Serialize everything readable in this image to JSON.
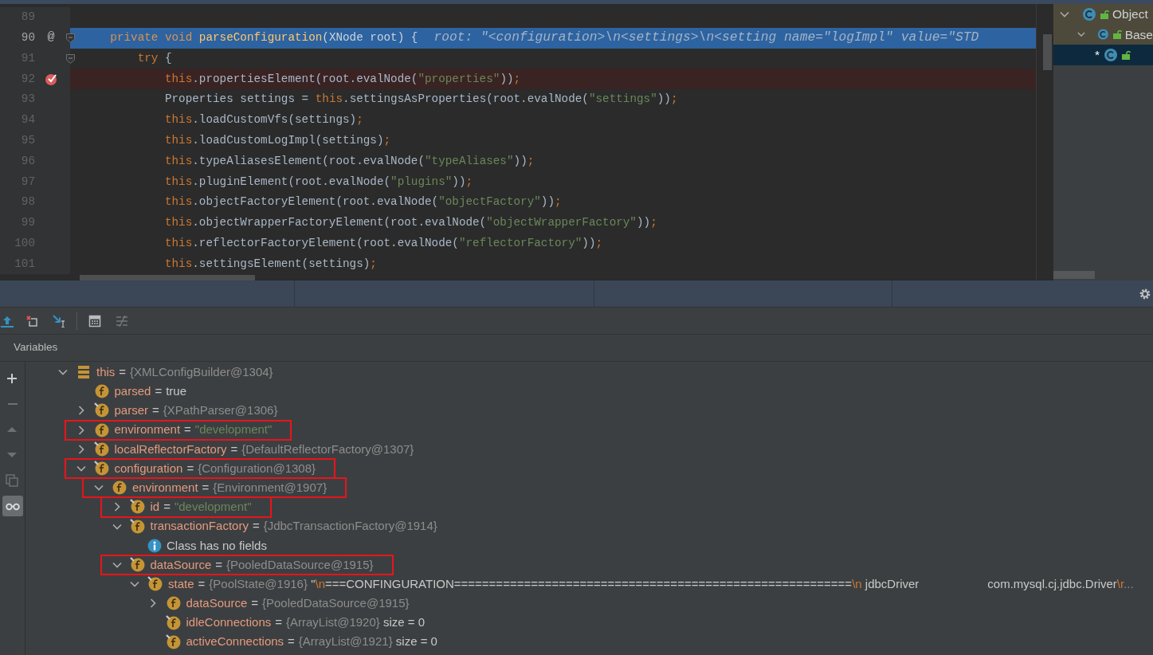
{
  "editor": {
    "lines": [
      {
        "number": "89"
      },
      {
        "number": "90",
        "current": true,
        "gutter_mark": "@",
        "foldable": true,
        "code": [
          {
            "kind": "kw",
            "text": "    private void "
          },
          {
            "kind": "fn",
            "text": "parseConfiguration"
          },
          {
            "kind": "plain",
            "text": "(XNode root) {"
          }
        ],
        "hint": "root: \"<configuration>\\n<settings>\\n<setting name=\"logImpl\" value=\"STD"
      },
      {
        "number": "91",
        "foldable": true,
        "code": [
          {
            "kind": "kw",
            "text": "        try"
          },
          {
            "kind": "plain",
            "text": " {"
          }
        ]
      },
      {
        "number": "92",
        "breakpoint": true,
        "code": [
          {
            "kind": "kw",
            "text": "            this"
          },
          {
            "kind": "plain",
            "text": ".propertiesElement(root.evalNode("
          },
          {
            "kind": "str",
            "text": "\"properties\""
          },
          {
            "kind": "plain",
            "text": "))"
          },
          {
            "kind": "semi",
            "text": ";"
          }
        ]
      },
      {
        "number": "93",
        "code": [
          {
            "kind": "plain",
            "text": "            Properties settings = "
          },
          {
            "kind": "kw",
            "text": "this"
          },
          {
            "kind": "plain",
            "text": ".settingsAsProperties(root.evalNode("
          },
          {
            "kind": "str",
            "text": "\"settings\""
          },
          {
            "kind": "plain",
            "text": "))"
          },
          {
            "kind": "semi",
            "text": ";"
          }
        ]
      },
      {
        "number": "94",
        "code": [
          {
            "kind": "kw",
            "text": "            this"
          },
          {
            "kind": "plain",
            "text": ".loadCustomVfs(settings)"
          },
          {
            "kind": "semi",
            "text": ";"
          }
        ]
      },
      {
        "number": "95",
        "code": [
          {
            "kind": "kw",
            "text": "            this"
          },
          {
            "kind": "plain",
            "text": ".loadCustomLogImpl(settings)"
          },
          {
            "kind": "semi",
            "text": ";"
          }
        ]
      },
      {
        "number": "96",
        "code": [
          {
            "kind": "kw",
            "text": "            this"
          },
          {
            "kind": "plain",
            "text": ".typeAliasesElement(root.evalNode("
          },
          {
            "kind": "str",
            "text": "\"typeAliases\""
          },
          {
            "kind": "plain",
            "text": "))"
          },
          {
            "kind": "semi",
            "text": ";"
          }
        ]
      },
      {
        "number": "97",
        "code": [
          {
            "kind": "kw",
            "text": "            this"
          },
          {
            "kind": "plain",
            "text": ".pluginElement(root.evalNode("
          },
          {
            "kind": "str",
            "text": "\"plugins\""
          },
          {
            "kind": "plain",
            "text": "))"
          },
          {
            "kind": "semi",
            "text": ";"
          }
        ]
      },
      {
        "number": "98",
        "code": [
          {
            "kind": "kw",
            "text": "            this"
          },
          {
            "kind": "plain",
            "text": ".objectFactoryElement(root.evalNode("
          },
          {
            "kind": "str",
            "text": "\"objectFactory\""
          },
          {
            "kind": "plain",
            "text": "))"
          },
          {
            "kind": "semi",
            "text": ";"
          }
        ]
      },
      {
        "number": "99",
        "code": [
          {
            "kind": "kw",
            "text": "            this"
          },
          {
            "kind": "plain",
            "text": ".objectWrapperFactoryElement(root.evalNode("
          },
          {
            "kind": "str",
            "text": "\"objectWrapperFactory\""
          },
          {
            "kind": "plain",
            "text": "))"
          },
          {
            "kind": "semi",
            "text": ";"
          }
        ]
      },
      {
        "number": "100",
        "code": [
          {
            "kind": "kw",
            "text": "            this"
          },
          {
            "kind": "plain",
            "text": ".reflectorFactoryElement(root.evalNode("
          },
          {
            "kind": "str",
            "text": "\"reflectorFactory\""
          },
          {
            "kind": "plain",
            "text": "))"
          },
          {
            "kind": "semi",
            "text": ";"
          }
        ]
      },
      {
        "number": "101",
        "code": [
          {
            "kind": "kw",
            "text": "            this"
          },
          {
            "kind": "plain",
            "text": ".settingsElement(settings)"
          },
          {
            "kind": "semi",
            "text": ";"
          }
        ]
      }
    ]
  },
  "structure": [
    {
      "label": "Object",
      "expanded": true,
      "highlighted": true,
      "selected": false,
      "children": [
        {
          "label": "Base",
          "expanded": true,
          "highlighted": true,
          "selected": false,
          "children": [
            {
              "label": "*",
              "highlighted": false,
              "selected": true
            }
          ]
        }
      ]
    }
  ],
  "debug_toolbar": [
    {
      "kind": "execution-point",
      "disabled": false
    },
    {
      "kind": "drop-frame",
      "disabled": false
    },
    {
      "kind": "run-to-cursor",
      "disabled": false
    },
    {
      "kind": "separator"
    },
    {
      "kind": "evaluate",
      "disabled": false
    },
    {
      "kind": "trace",
      "disabled": true
    }
  ],
  "variables": {
    "title": "Variables",
    "side_buttons": [
      {
        "kind": "add",
        "disabled": false,
        "selected": false
      },
      {
        "kind": "remove",
        "disabled": true,
        "selected": false
      },
      {
        "kind": "up",
        "disabled": true,
        "selected": false
      },
      {
        "kind": "down",
        "disabled": true,
        "selected": false
      },
      {
        "kind": "copy",
        "disabled": true,
        "selected": false
      },
      {
        "kind": "watches",
        "disabled": false,
        "selected": true
      }
    ],
    "tree": [
      {
        "kind": "object",
        "name": "this",
        "operator": "=",
        "expanded": true,
        "highlighted": false,
        "final": false,
        "parts": [
          {
            "kind": "ref",
            "text": "{XMLConfigBuilder@1304}"
          }
        ],
        "children": [
          {
            "kind": "field",
            "name": "parsed",
            "operator": "=",
            "highlighted": false,
            "final": false,
            "parts": [
              {
                "kind": "literal",
                "text": "true"
              }
            ]
          },
          {
            "kind": "field",
            "name": "parser",
            "operator": "=",
            "expanded": false,
            "highlighted": false,
            "final": true,
            "parts": [
              {
                "kind": "ref",
                "text": "{XPathParser@1306}"
              }
            ]
          },
          {
            "kind": "field",
            "name": "environment",
            "operator": "=",
            "expanded": false,
            "highlighted": true,
            "final": false,
            "parts": [
              {
                "kind": "string",
                "text": "\"development\""
              }
            ]
          },
          {
            "kind": "field",
            "name": "localReflectorFactory",
            "operator": "=",
            "expanded": false,
            "highlighted": false,
            "final": true,
            "parts": [
              {
                "kind": "ref",
                "text": "{DefaultReflectorFactory@1307}"
              }
            ]
          },
          {
            "kind": "field",
            "name": "configuration",
            "operator": "=",
            "expanded": true,
            "highlighted": true,
            "final": true,
            "parts": [
              {
                "kind": "ref",
                "text": "{Configuration@1308}"
              }
            ],
            "children": [
              {
                "kind": "field",
                "name": "environment",
                "operator": "=",
                "expanded": true,
                "highlighted": true,
                "final": false,
                "parts": [
                  {
                    "kind": "ref",
                    "text": "{Environment@1907}"
                  }
                ],
                "children": [
                  {
                    "kind": "field",
                    "name": "id",
                    "operator": "=",
                    "expanded": false,
                    "highlighted": true,
                    "final": true,
                    "parts": [
                      {
                        "kind": "string",
                        "text": "\"development\""
                      }
                    ]
                  },
                  {
                    "kind": "field",
                    "name": "transactionFactory",
                    "operator": "=",
                    "expanded": true,
                    "highlighted": false,
                    "final": true,
                    "parts": [
                      {
                        "kind": "ref",
                        "text": "{JdbcTransactionFactory@1914}"
                      }
                    ],
                    "children": [
                      {
                        "kind": "message",
                        "text": "Class has no fields"
                      }
                    ]
                  },
                  {
                    "kind": "field",
                    "name": "dataSource",
                    "operator": "=",
                    "expanded": true,
                    "highlighted": true,
                    "final": true,
                    "parts": [
                      {
                        "kind": "ref",
                        "text": "{PooledDataSource@1915}"
                      }
                    ],
                    "children": [
                      {
                        "kind": "field",
                        "name": "state",
                        "operator": "=",
                        "expanded": true,
                        "highlighted": false,
                        "final": true,
                        "parts": [
                          {
                            "kind": "ref",
                            "text": "{PoolState@1916}"
                          },
                          {
                            "kind": "literal",
                            "text": " \""
                          },
                          {
                            "kind": "escape",
                            "text": "\\n"
                          },
                          {
                            "kind": "literal",
                            "text": "===CONFINGURATION========================================================="
                          },
                          {
                            "kind": "escape",
                            "text": "\\n"
                          },
                          {
                            "kind": "literal",
                            "text": " jdbcDriver"
                          },
                          {
                            "kind": "literal",
                            "text": "com.mysql.cj.jdbc.Driver",
                            "tab": true
                          },
                          {
                            "kind": "escape",
                            "text": "\\r"
                          },
                          {
                            "kind": "ellipsis",
                            "text": "..."
                          }
                        ],
                        "children": [
                          {
                            "kind": "field",
                            "name": "dataSource",
                            "operator": "=",
                            "expanded": false,
                            "highlighted": false,
                            "final": false,
                            "parts": [
                              {
                                "kind": "ref",
                                "text": "{PooledDataSource@1915}"
                              }
                            ]
                          },
                          {
                            "kind": "field",
                            "name": "idleConnections",
                            "operator": "=",
                            "highlighted": false,
                            "final": true,
                            "parts": [
                              {
                                "kind": "ref",
                                "text": "{ArrayList@1920}"
                              },
                              {
                                "kind": "literal",
                                "text": "  size = 0"
                              }
                            ]
                          },
                          {
                            "kind": "field",
                            "name": "activeConnections",
                            "operator": "=",
                            "highlighted": false,
                            "final": true,
                            "parts": [
                              {
                                "kind": "ref",
                                "text": "{ArrayList@1921}"
                              },
                              {
                                "kind": "literal",
                                "text": "  size = 0"
                              }
                            ]
                          }
                        ]
                      }
                    ]
                  }
                ]
              }
            ]
          }
        ]
      }
    ]
  }
}
